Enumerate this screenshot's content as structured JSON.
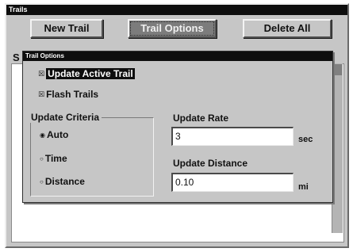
{
  "window": {
    "title": "Trails"
  },
  "toolbar": {
    "new_trail": "New Trail",
    "trail_options": "Trail Options",
    "delete_all": "Delete All"
  },
  "background": {
    "list_label": "S"
  },
  "dialog": {
    "title": "Trail Options",
    "update_active_trail": {
      "label": "Update Active Trail",
      "checked": true
    },
    "flash_trails": {
      "label": "Flash Trails",
      "checked": true
    },
    "update_criteria": {
      "title": "Update Criteria",
      "options": [
        "Auto",
        "Time",
        "Distance"
      ],
      "selected": "Auto"
    },
    "update_rate": {
      "label": "Update Rate",
      "value": "3",
      "unit": "sec"
    },
    "update_distance": {
      "label": "Update Distance",
      "value": "0.10",
      "unit": "mi"
    }
  }
}
